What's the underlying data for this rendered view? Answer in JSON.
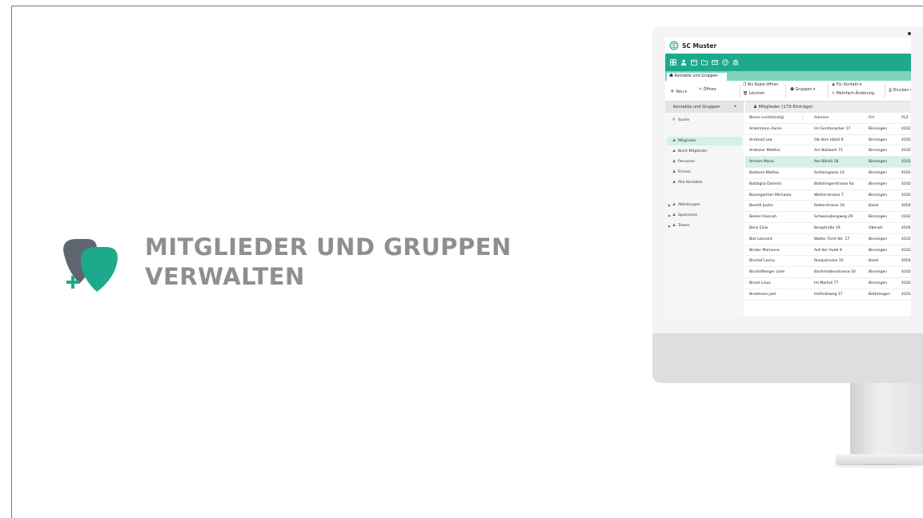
{
  "headline": {
    "line1": "MITGLIEDER UND GRUPPEN",
    "line2": "VERWALTEN"
  },
  "colors": {
    "brand_green": "#1fa98c",
    "tab_strip": "#7fd1bd",
    "selection": "#d6efe8",
    "headline_gray": "#8f8f8f"
  },
  "app": {
    "title": "SC Muster",
    "toolbar_icons": [
      "dashboard-icon",
      "person-icon",
      "calendar-icon",
      "folder-icon",
      "mail-icon",
      "globe-icon",
      "bank-icon"
    ],
    "tab": "Kontakte und Gruppen",
    "ribbon": {
      "new": "Neu",
      "open": "Öffnen",
      "copy_open": "Als Kopie öffnen",
      "delete": "Löschen",
      "groups": "Gruppen",
      "for_contact": "Für Kontakt",
      "multi_change": "Mehrfach-Änderung",
      "print": "Drucken"
    },
    "left_pane": {
      "title": "Kontakte und Gruppen",
      "search": "Suche",
      "items": [
        "Mitglieder",
        "Nicht-Mitglieder",
        "Personen",
        "Firmen",
        "Alle Kontakte"
      ],
      "groups": [
        "Abteilungen",
        "Sponsoren",
        "Teams"
      ]
    },
    "main_pane": {
      "title": "Mitglieder (179 Einträge)",
      "columns": [
        "Name (vollständig)",
        "Adresse",
        "Ort",
        "PLZ"
      ],
      "rows": [
        [
          "Ackermann Aaron",
          "Im Gerstenacker 17",
          "Binningen",
          "4102"
        ],
        [
          "Andreoli Lea",
          "Ob dem Hölzli 6",
          "Binningen",
          "4102"
        ],
        [
          "Ardesser Matthis",
          "Am Bollwerk 71",
          "Binningen",
          "4102"
        ],
        [
          "Arheim Maria",
          "Am Bächli 18",
          "Binningen",
          "4102"
        ],
        [
          "Barbone Matteo",
          "Schlossgasse 14",
          "Binningen",
          "4102"
        ],
        [
          "Battaglia Dominic",
          "Bottmingerstrasse 6a",
          "Binningen",
          "4102"
        ],
        [
          "Baumgartner Michaela",
          "Weiherstrasse 7",
          "Binningen",
          "4102"
        ],
        [
          "Bearth Justin",
          "Rotterstrasse 16",
          "Basel",
          "4054"
        ],
        [
          "Beeler Hannah",
          "Schweissbergweg 29",
          "Binningen",
          "4102"
        ],
        [
          "Benz Elias",
          "Bergstraße 19",
          "Oberwil",
          "4104"
        ],
        [
          "Biel Leonard",
          "Walter Fürst-Str. 17",
          "Binningen",
          "4102"
        ],
        [
          "Binder Marianne",
          "Auf der Hueb 9",
          "Binningen",
          "4102"
        ],
        [
          "Bischof Lenny",
          "Realpstrasse 10",
          "Basel",
          "4054"
        ],
        [
          "Bischofberger Liam",
          "Bachmattenstrasse 16",
          "Binningen",
          "4102"
        ],
        [
          "Bissel Linus",
          "Im Martoli 77",
          "Binningen",
          "4102"
        ],
        [
          "Brodmann Joel",
          "Hofmattweg 17",
          "Bottmingen",
          "4103"
        ]
      ],
      "selected_row_index": 3
    }
  }
}
